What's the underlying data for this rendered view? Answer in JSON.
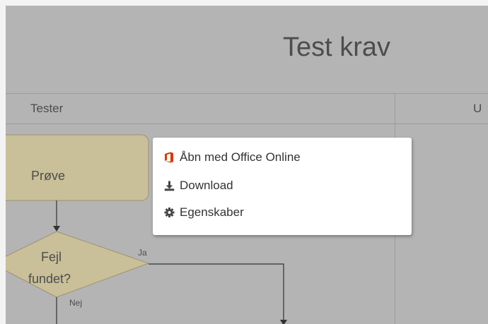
{
  "diagram": {
    "title": "Test krav",
    "lanes": [
      {
        "label": "Tester"
      },
      {
        "label": "U"
      }
    ],
    "nodes": {
      "process": {
        "label": "Prøve"
      },
      "decision": {
        "line1": "Fejl",
        "line2": "fundet?"
      }
    },
    "edges": {
      "yes_label": "Ja",
      "no_label": "Nej"
    }
  },
  "context_menu": {
    "items": [
      {
        "label": "Åbn med Office Online",
        "icon": "office-icon"
      },
      {
        "label": "Download",
        "icon": "download-icon"
      },
      {
        "label": "Egenskaber",
        "icon": "gear-icon"
      }
    ]
  },
  "colors": {
    "canvas_background": "#b4b4b4",
    "shape_fill": "#c9bf98",
    "office_icon": "#d83b01",
    "menu_icon": "#444444"
  }
}
